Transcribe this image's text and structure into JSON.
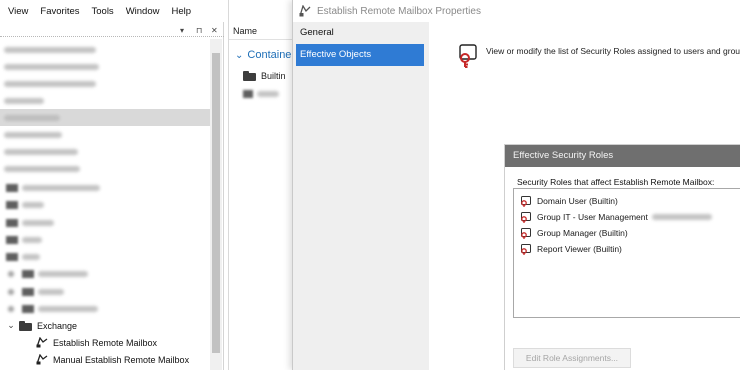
{
  "menubar": {
    "items": [
      "View",
      "Favorites",
      "Tools",
      "Window",
      "Help"
    ]
  },
  "pane_toolbar": {
    "dropdown_glyph": "▾",
    "pin_glyph": "⊓",
    "close_glyph": "✕"
  },
  "tree": {
    "exchange_label": "Exchange",
    "establish_label": "Establish Remote Mailbox",
    "manual_label": "Manual Establish Remote Mailbox",
    "icon_expanded": "chevron-down-icon",
    "icon_collapsed": "chevron-right-icon"
  },
  "list_pane": {
    "column_name": "Name",
    "group_header": "Containe",
    "builtin_label": "Builtin"
  },
  "properties": {
    "title": "Establish Remote Mailbox Properties",
    "nav_general": "General",
    "nav_effective": "Effective Objects",
    "info_text": "View or modify the list of Security Roles assigned to users and group",
    "roles_title": "Effective Security Roles",
    "roles_subtitle": "Security Roles that affect Establish Remote Mailbox:",
    "roles": [
      "Domain User (Builtin)",
      "Group IT - User Management",
      "Group Manager (Builtin)",
      "Report Viewer (Builtin)"
    ],
    "edit_button": "Edit Role Assignments..."
  },
  "colors": {
    "accent": "#2f7bd4",
    "group_header": "#1f6fb7",
    "roles_title_bg": "#6f6f6f",
    "nav_bg": "#efefef",
    "role_icon": "#c62828"
  }
}
